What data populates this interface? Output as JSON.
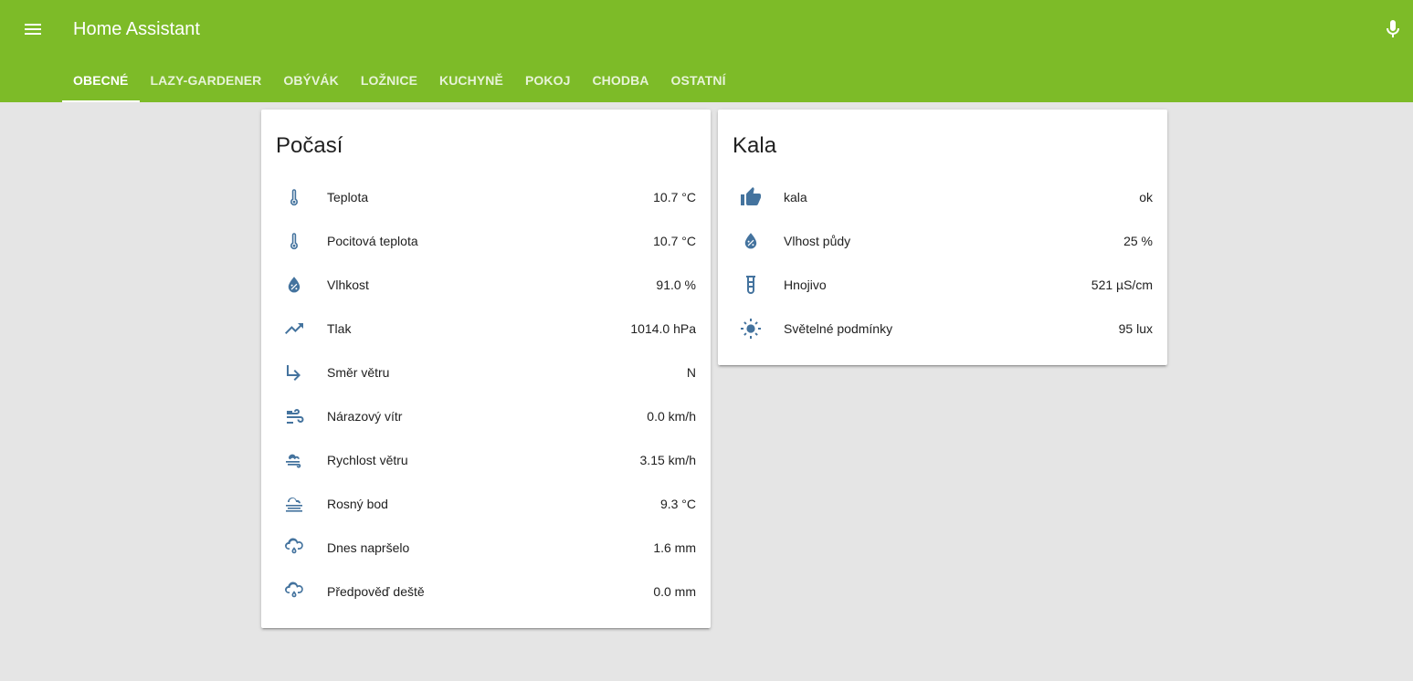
{
  "app": {
    "title": "Home Assistant",
    "accent_color": "#7dbb28",
    "icon_color": "#44739e"
  },
  "header": {
    "menu_icon": "menu-icon",
    "mic_icon": "microphone-icon"
  },
  "tabs": [
    {
      "label": "OBECNÉ",
      "active": true
    },
    {
      "label": "LAZY-GARDENER",
      "active": false
    },
    {
      "label": "OBÝVÁK",
      "active": false
    },
    {
      "label": "LOŽNICE",
      "active": false
    },
    {
      "label": "KUCHYNĚ",
      "active": false
    },
    {
      "label": "POKOJ",
      "active": false
    },
    {
      "label": "CHODBA",
      "active": false
    },
    {
      "label": "OSTATNÍ",
      "active": false
    }
  ],
  "cards": {
    "weather": {
      "title": "Počasí",
      "rows": [
        {
          "icon": "thermometer-icon",
          "label": "Teplota",
          "value": "10.7 °C"
        },
        {
          "icon": "thermometer-icon",
          "label": "Pocitová teplota",
          "value": "10.7 °C"
        },
        {
          "icon": "water-percent-icon",
          "label": "Vlhkost",
          "value": "91.0 %"
        },
        {
          "icon": "trending-up-icon",
          "label": "Tlak",
          "value": "1014.0 hPa"
        },
        {
          "icon": "subdirectory-arrow-right-icon",
          "label": "Směr větru",
          "value": "N"
        },
        {
          "icon": "weather-windy-icon",
          "label": "Nárazový vítr",
          "value": "0.0 km/h"
        },
        {
          "icon": "weather-windy-cloud-icon",
          "label": "Rychlost větru",
          "value": "3.15 km/h"
        },
        {
          "icon": "weather-fog-icon",
          "label": "Rosný bod",
          "value": "9.3 °C"
        },
        {
          "icon": "weather-rainy-icon",
          "label": "Dnes napršelo",
          "value": "1.6 mm"
        },
        {
          "icon": "weather-rainy-icon",
          "label": "Předpověď deště",
          "value": "0.0 mm"
        }
      ]
    },
    "kala": {
      "title": "Kala",
      "rows": [
        {
          "icon": "thumb-up-icon",
          "label": "kala",
          "value": "ok"
        },
        {
          "icon": "water-percent-icon",
          "label": "Vlhost půdy",
          "value": "25 %"
        },
        {
          "icon": "test-tube-icon",
          "label": "Hnojivo",
          "value": "521 µS/cm"
        },
        {
          "icon": "white-balance-sunny-icon",
          "label": "Světelné podmínky",
          "value": "95 lux"
        }
      ]
    }
  }
}
